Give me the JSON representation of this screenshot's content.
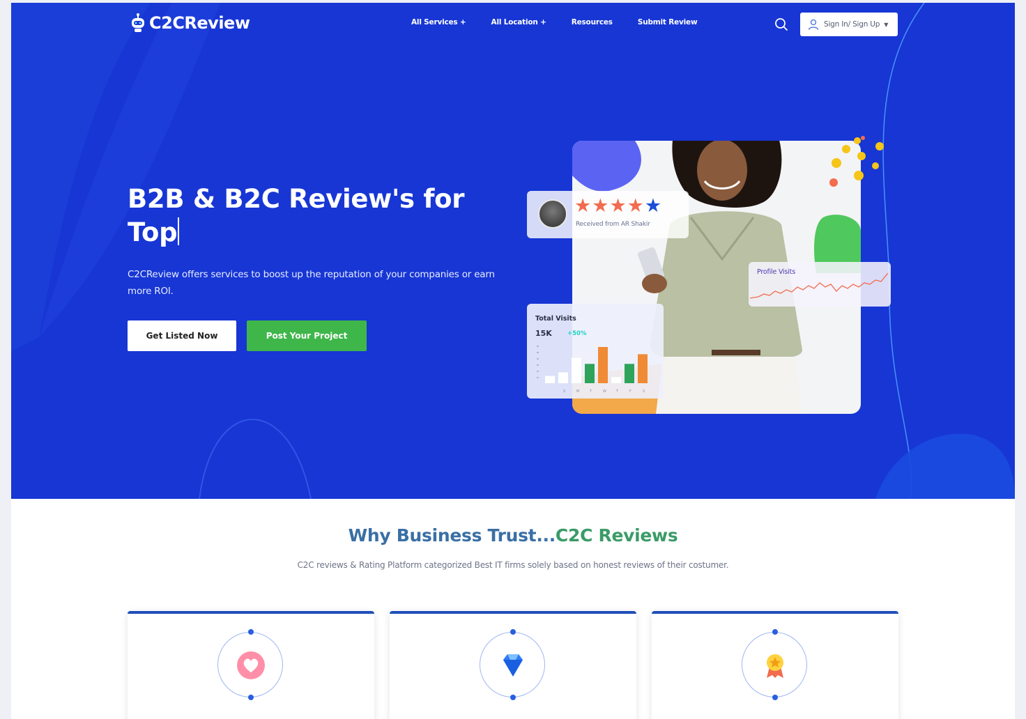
{
  "brand": {
    "logo_text": "C2CReview"
  },
  "nav": {
    "items": [
      {
        "label": "All Services +"
      },
      {
        "label": "All Location +"
      },
      {
        "label": "Resources"
      },
      {
        "label": "Submit Review"
      }
    ],
    "search_icon": "search-icon",
    "signin_label": "Sign In/ Sign Up"
  },
  "hero": {
    "title": "B2B & B2C Review's for Top",
    "description": "C2CReview offers services to boost up the reputation of your companies or earn more ROI.",
    "cta_primary": "Get Listed Now",
    "cta_secondary": "Post Your Project",
    "background_color": "#1736d4",
    "secondary_color": "#3fb64a"
  },
  "illustration": {
    "rating_card": {
      "stars_filled": 5,
      "from_text": "Received from AR Shakir"
    },
    "visits_card": {
      "title": "Total Visits",
      "value": "15K",
      "change": "+50%",
      "chart_data": {
        "type": "bar",
        "categories": [
          "S",
          "M",
          "T",
          "W",
          "T",
          "F",
          "S"
        ],
        "values": [
          [
            12,
            18
          ],
          [
            42
          ],
          [
            32
          ],
          [
            60
          ],
          [
            10
          ],
          [
            32
          ],
          [
            48
          ]
        ]
      }
    },
    "profile_card": {
      "title": "Profile Visits"
    }
  },
  "trust": {
    "title_part1": "Why Business Trust...",
    "title_part2": "C2C Reviews",
    "subtitle": "C2C reviews & Rating Platform categorized Best IT firms solely based on honest reviews of their costumer.",
    "cards": [
      {
        "icon": "heart-icon"
      },
      {
        "icon": "diamond-icon"
      },
      {
        "icon": "award-icon"
      }
    ]
  }
}
